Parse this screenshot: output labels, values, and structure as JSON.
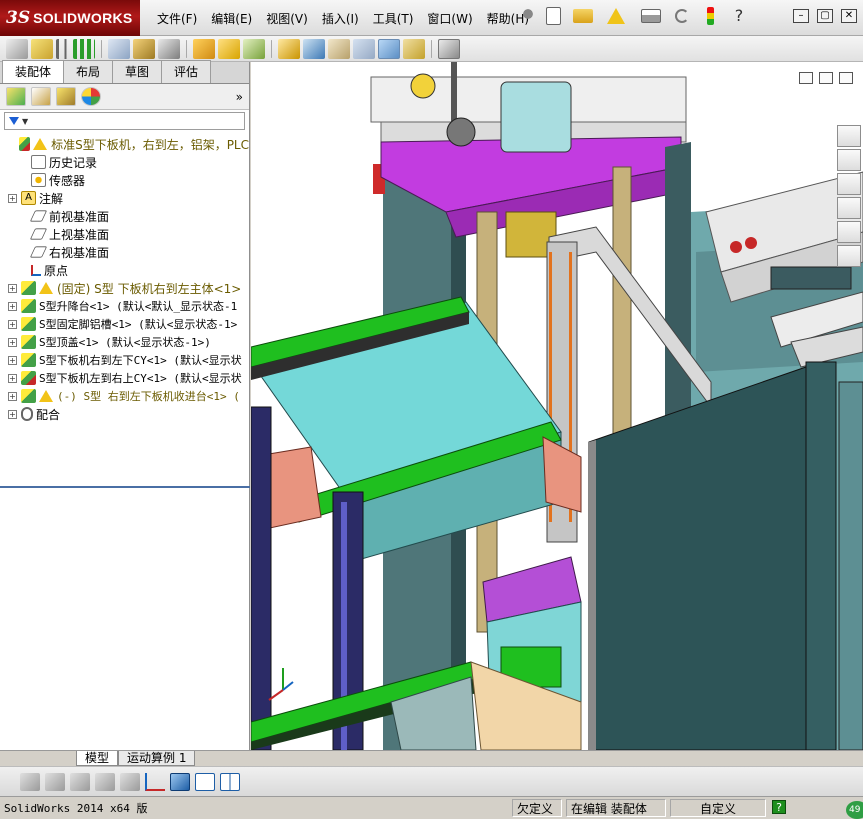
{
  "app": {
    "logo_ds": "3S",
    "logo_name": "SOLIDWORKS"
  },
  "menu": [
    "文件(F)",
    "编辑(E)",
    "视图(V)",
    "插入(I)",
    "工具(T)",
    "窗口(W)",
    "帮助(H)"
  ],
  "left_panel": {
    "tabs": [
      "装配体",
      "布局",
      "草图",
      "评估"
    ],
    "active_tab": "装配体",
    "more_label": "»",
    "filter_icon": "filter-icon",
    "tree": [
      {
        "label": "标准S型下板机，右到左，铝架，PLC",
        "icon": "assembly-warning-icon",
        "expander": false,
        "style": "top"
      },
      {
        "label": "历史记录",
        "icon": "history-icon",
        "expander": false,
        "style": "plain"
      },
      {
        "label": "传感器",
        "icon": "sensor-icon",
        "expander": false,
        "style": "plain"
      },
      {
        "label": "注解",
        "icon": "annotation-icon",
        "expander": true,
        "style": "plain"
      },
      {
        "label": "前视基准面",
        "icon": "plane-icon",
        "expander": false,
        "style": "plain"
      },
      {
        "label": "上视基准面",
        "icon": "plane-icon",
        "expander": false,
        "style": "plain"
      },
      {
        "label": "右视基准面",
        "icon": "plane-icon",
        "expander": false,
        "style": "plain"
      },
      {
        "label": "原点",
        "icon": "origin-icon",
        "expander": false,
        "style": "plain"
      },
      {
        "label": "(固定) S型 下板机右到左主体<1>",
        "icon": "subassembly-warning-icon",
        "expander": true,
        "style": "fixed"
      },
      {
        "label": "S型升降台<1> (默认<默认_显示状态-1",
        "icon": "subassembly-icon",
        "expander": true,
        "style": "mono"
      },
      {
        "label": "S型固定脚铝槽<1> (默认<显示状态-1>",
        "icon": "subassembly-icon",
        "expander": true,
        "style": "mono"
      },
      {
        "label": "S型顶盖<1> (默认<显示状态-1>)",
        "icon": "subassembly-icon",
        "expander": true,
        "style": "mono"
      },
      {
        "label": "S型下板机右到左下CY<1> (默认<显示状",
        "icon": "subassembly-icon",
        "expander": true,
        "style": "mono"
      },
      {
        "label": "S型下板机左到右上CY<1> (默认<显示状",
        "icon": "subassembly-cy-icon",
        "expander": true,
        "style": "mono"
      },
      {
        "label": "(-) S型 右到左下板机收进台<1> (",
        "icon": "subassembly-warning-icon",
        "expander": true,
        "style": "fixed"
      },
      {
        "label": "配合",
        "icon": "mates-icon",
        "expander": true,
        "style": "plain"
      }
    ]
  },
  "bottom_tabs": [
    "模型",
    "运动算例 1"
  ],
  "status": {
    "app_text": "SolidWorks 2014 x64 版",
    "underdefined": "欠定义",
    "editing": "在编辑 装配体",
    "units": "自定义",
    "help_icon": "help-icon",
    "badge": "49"
  },
  "colors": {
    "brand_red": "#a81515",
    "magenta": "#c23ce0",
    "cyan": "#6ad2d2",
    "green": "#18c418",
    "steel": "#4a6f72"
  }
}
